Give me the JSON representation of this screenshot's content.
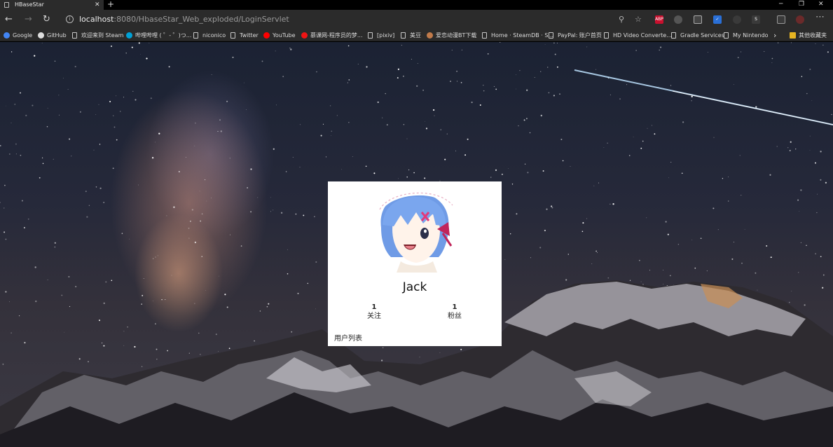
{
  "browser": {
    "tab_title": "HBaseStar",
    "url_host": "localhost",
    "url_rest": ":8080/HbaseStar_Web_exploded/LoginServlet",
    "bookmarks": [
      {
        "label": "Google",
        "icon": "google-icon",
        "color": "#4285f4"
      },
      {
        "label": "GitHub",
        "icon": "github-icon",
        "color": "#dddddd"
      },
      {
        "label": "欢迎来到 Steam",
        "icon": "page-icon",
        "color": ""
      },
      {
        "label": "哔哩哔哩 ( ゜- ゜)つ...",
        "icon": "bilibili-icon",
        "color": "#00a1d6"
      },
      {
        "label": "niconico",
        "icon": "page-icon",
        "color": ""
      },
      {
        "label": "Twitter",
        "icon": "page-icon",
        "color": ""
      },
      {
        "label": "YouTube",
        "icon": "youtube-icon",
        "color": "#ff0000"
      },
      {
        "label": "慕课网-程序员的梦...",
        "icon": "imooc-icon",
        "color": "#f01414"
      },
      {
        "label": "[pixiv]",
        "icon": "page-icon",
        "color": ""
      },
      {
        "label": "美豆",
        "icon": "page-icon",
        "color": ""
      },
      {
        "label": "爱恋动漫BT下载",
        "icon": "anime-icon",
        "color": "#c07a4a"
      },
      {
        "label": "Home · SteamDB · S...",
        "icon": "page-icon",
        "color": ""
      },
      {
        "label": "PayPal: 账户首页",
        "icon": "page-icon",
        "color": ""
      },
      {
        "label": "HD Video Converte...",
        "icon": "page-icon",
        "color": ""
      },
      {
        "label": "Gradle Services",
        "icon": "page-icon",
        "color": ""
      },
      {
        "label": "My Nintendo",
        "icon": "page-icon",
        "color": ""
      }
    ],
    "other_bookmarks": "其他收藏夹"
  },
  "profile": {
    "name": "Jack",
    "following_count": "1",
    "following_label": "关注",
    "followers_count": "1",
    "followers_label": "粉丝",
    "user_list_link": "用户列表"
  }
}
